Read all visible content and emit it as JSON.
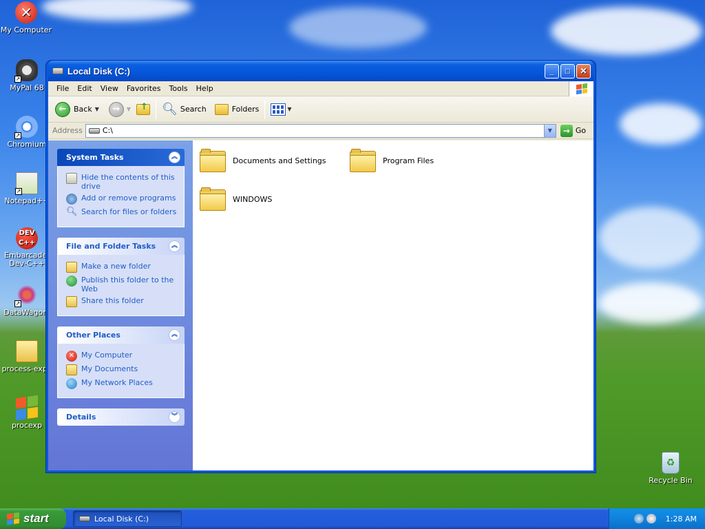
{
  "desktop": {
    "icons": [
      {
        "label": "My Computer"
      },
      {
        "label": "MyPal 68"
      },
      {
        "label": "Chromium"
      },
      {
        "label": "Notepad++"
      },
      {
        "label": "Embarcadero Dev-C++"
      },
      {
        "label": "DataWagon."
      },
      {
        "label": "process-expl."
      },
      {
        "label": "procexp"
      }
    ],
    "recycle_bin": "Recycle Bin"
  },
  "window": {
    "title": "Local Disk (C:)",
    "menu": [
      "File",
      "Edit",
      "View",
      "Favorites",
      "Tools",
      "Help"
    ],
    "toolbar": {
      "back": "Back",
      "search": "Search",
      "folders": "Folders"
    },
    "address": {
      "label": "Address",
      "value": "C:\\",
      "go": "Go"
    },
    "panels": {
      "system_tasks": {
        "title": "System Tasks",
        "items": [
          "Hide the contents of this drive",
          "Add or remove programs",
          "Search for files or folders"
        ]
      },
      "file_folder_tasks": {
        "title": "File and Folder Tasks",
        "items": [
          "Make a new folder",
          "Publish this folder to the Web",
          "Share this folder"
        ]
      },
      "other_places": {
        "title": "Other Places",
        "items": [
          "My Computer",
          "My Documents",
          "My Network Places"
        ]
      },
      "details": {
        "title": "Details"
      }
    },
    "files": [
      "Documents and Settings",
      "Program Files",
      "WINDOWS"
    ]
  },
  "taskbar": {
    "start": "start",
    "task": "Local Disk (C:)",
    "clock": "1:28 AM"
  }
}
